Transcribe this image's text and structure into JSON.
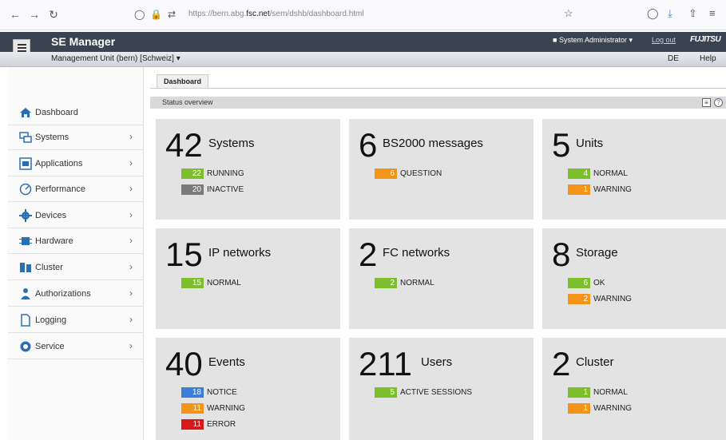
{
  "browser": {
    "url_prefix": "https://bern.abg.",
    "url_domain": "fsc.net",
    "url_path": "/sem/dshb/dashboard.html"
  },
  "header": {
    "title": "SE Manager",
    "user": "System Administrator ▾",
    "logout": "Log out",
    "brand": "FUJITSU",
    "management_unit": "Management Unit (bern) [Schweiz] ▾",
    "lang": "DE",
    "help": "Help"
  },
  "sidebar": {
    "items": [
      {
        "label": "Dashboard",
        "icon": "home-icon"
      },
      {
        "label": "Systems",
        "icon": "systems-icon"
      },
      {
        "label": "Applications",
        "icon": "applications-icon"
      },
      {
        "label": "Performance",
        "icon": "performance-icon"
      },
      {
        "label": "Devices",
        "icon": "devices-icon"
      },
      {
        "label": "Hardware",
        "icon": "hardware-icon"
      },
      {
        "label": "Cluster",
        "icon": "cluster-icon"
      },
      {
        "label": "Authorizations",
        "icon": "authorizations-icon"
      },
      {
        "label": "Logging",
        "icon": "logging-icon"
      },
      {
        "label": "Service",
        "icon": "service-icon"
      }
    ]
  },
  "content": {
    "tab": "Dashboard",
    "status_title": "Status overview"
  },
  "tiles": [
    {
      "count": "42",
      "label": "Systems",
      "badges": [
        {
          "n": "22",
          "text": "RUNNING",
          "color": "#7dbe2c"
        },
        {
          "n": "20",
          "text": "INACTIVE",
          "color": "#7a7a7a"
        }
      ]
    },
    {
      "count": "6",
      "label": "BS2000 messages",
      "badges": [
        {
          "n": "6",
          "text": "QUESTION",
          "color": "#f39419"
        }
      ]
    },
    {
      "count": "5",
      "label": "Units",
      "badges": [
        {
          "n": "4",
          "text": "NORMAL",
          "color": "#7dbe2c"
        },
        {
          "n": "1",
          "text": "WARNING",
          "color": "#f39419"
        }
      ]
    },
    {
      "count": "15",
      "label": "IP networks",
      "badges": [
        {
          "n": "15",
          "text": "NORMAL",
          "color": "#7dbe2c"
        }
      ]
    },
    {
      "count": "2",
      "label": "FC networks",
      "badges": [
        {
          "n": "2",
          "text": "NORMAL",
          "color": "#7dbe2c"
        }
      ]
    },
    {
      "count": "8",
      "label": "Storage",
      "badges": [
        {
          "n": "6",
          "text": "OK",
          "color": "#7dbe2c"
        },
        {
          "n": "2",
          "text": "WARNING",
          "color": "#f39419"
        }
      ]
    },
    {
      "count": "40",
      "label": "Events",
      "badges": [
        {
          "n": "18",
          "text": "NOTICE",
          "color": "#3b7dd8"
        },
        {
          "n": "11",
          "text": "WARNING",
          "color": "#f39419"
        },
        {
          "n": "11",
          "text": "ERROR",
          "color": "#d81818"
        }
      ]
    },
    {
      "count": "211",
      "label": "Users",
      "badges": [
        {
          "n": "5",
          "text": "ACTIVE SESSIONS",
          "color": "#7dbe2c"
        }
      ]
    },
    {
      "count": "2",
      "label": "Cluster",
      "badges": [
        {
          "n": "1",
          "text": "NORMAL",
          "color": "#7dbe2c"
        },
        {
          "n": "1",
          "text": "WARNING",
          "color": "#f39419"
        }
      ]
    }
  ]
}
